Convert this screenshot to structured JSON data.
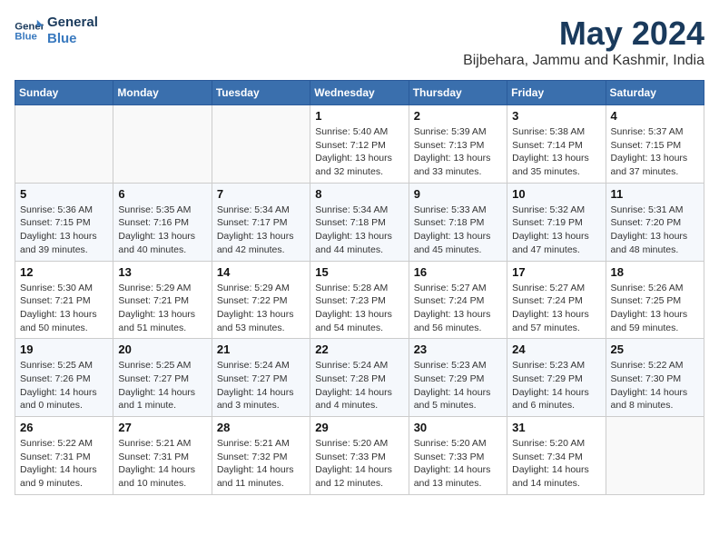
{
  "header": {
    "logo_line1": "General",
    "logo_line2": "Blue",
    "month": "May 2024",
    "location": "Bijbehara, Jammu and Kashmir, India"
  },
  "weekdays": [
    "Sunday",
    "Monday",
    "Tuesday",
    "Wednesday",
    "Thursday",
    "Friday",
    "Saturday"
  ],
  "weeks": [
    [
      {
        "date": "",
        "info": ""
      },
      {
        "date": "",
        "info": ""
      },
      {
        "date": "",
        "info": ""
      },
      {
        "date": "1",
        "info": "Sunrise: 5:40 AM\nSunset: 7:12 PM\nDaylight: 13 hours\nand 32 minutes."
      },
      {
        "date": "2",
        "info": "Sunrise: 5:39 AM\nSunset: 7:13 PM\nDaylight: 13 hours\nand 33 minutes."
      },
      {
        "date": "3",
        "info": "Sunrise: 5:38 AM\nSunset: 7:14 PM\nDaylight: 13 hours\nand 35 minutes."
      },
      {
        "date": "4",
        "info": "Sunrise: 5:37 AM\nSunset: 7:15 PM\nDaylight: 13 hours\nand 37 minutes."
      }
    ],
    [
      {
        "date": "5",
        "info": "Sunrise: 5:36 AM\nSunset: 7:15 PM\nDaylight: 13 hours\nand 39 minutes."
      },
      {
        "date": "6",
        "info": "Sunrise: 5:35 AM\nSunset: 7:16 PM\nDaylight: 13 hours\nand 40 minutes."
      },
      {
        "date": "7",
        "info": "Sunrise: 5:34 AM\nSunset: 7:17 PM\nDaylight: 13 hours\nand 42 minutes."
      },
      {
        "date": "8",
        "info": "Sunrise: 5:34 AM\nSunset: 7:18 PM\nDaylight: 13 hours\nand 44 minutes."
      },
      {
        "date": "9",
        "info": "Sunrise: 5:33 AM\nSunset: 7:18 PM\nDaylight: 13 hours\nand 45 minutes."
      },
      {
        "date": "10",
        "info": "Sunrise: 5:32 AM\nSunset: 7:19 PM\nDaylight: 13 hours\nand 47 minutes."
      },
      {
        "date": "11",
        "info": "Sunrise: 5:31 AM\nSunset: 7:20 PM\nDaylight: 13 hours\nand 48 minutes."
      }
    ],
    [
      {
        "date": "12",
        "info": "Sunrise: 5:30 AM\nSunset: 7:21 PM\nDaylight: 13 hours\nand 50 minutes."
      },
      {
        "date": "13",
        "info": "Sunrise: 5:29 AM\nSunset: 7:21 PM\nDaylight: 13 hours\nand 51 minutes."
      },
      {
        "date": "14",
        "info": "Sunrise: 5:29 AM\nSunset: 7:22 PM\nDaylight: 13 hours\nand 53 minutes."
      },
      {
        "date": "15",
        "info": "Sunrise: 5:28 AM\nSunset: 7:23 PM\nDaylight: 13 hours\nand 54 minutes."
      },
      {
        "date": "16",
        "info": "Sunrise: 5:27 AM\nSunset: 7:24 PM\nDaylight: 13 hours\nand 56 minutes."
      },
      {
        "date": "17",
        "info": "Sunrise: 5:27 AM\nSunset: 7:24 PM\nDaylight: 13 hours\nand 57 minutes."
      },
      {
        "date": "18",
        "info": "Sunrise: 5:26 AM\nSunset: 7:25 PM\nDaylight: 13 hours\nand 59 minutes."
      }
    ],
    [
      {
        "date": "19",
        "info": "Sunrise: 5:25 AM\nSunset: 7:26 PM\nDaylight: 14 hours\nand 0 minutes."
      },
      {
        "date": "20",
        "info": "Sunrise: 5:25 AM\nSunset: 7:27 PM\nDaylight: 14 hours\nand 1 minute."
      },
      {
        "date": "21",
        "info": "Sunrise: 5:24 AM\nSunset: 7:27 PM\nDaylight: 14 hours\nand 3 minutes."
      },
      {
        "date": "22",
        "info": "Sunrise: 5:24 AM\nSunset: 7:28 PM\nDaylight: 14 hours\nand 4 minutes."
      },
      {
        "date": "23",
        "info": "Sunrise: 5:23 AM\nSunset: 7:29 PM\nDaylight: 14 hours\nand 5 minutes."
      },
      {
        "date": "24",
        "info": "Sunrise: 5:23 AM\nSunset: 7:29 PM\nDaylight: 14 hours\nand 6 minutes."
      },
      {
        "date": "25",
        "info": "Sunrise: 5:22 AM\nSunset: 7:30 PM\nDaylight: 14 hours\nand 8 minutes."
      }
    ],
    [
      {
        "date": "26",
        "info": "Sunrise: 5:22 AM\nSunset: 7:31 PM\nDaylight: 14 hours\nand 9 minutes."
      },
      {
        "date": "27",
        "info": "Sunrise: 5:21 AM\nSunset: 7:31 PM\nDaylight: 14 hours\nand 10 minutes."
      },
      {
        "date": "28",
        "info": "Sunrise: 5:21 AM\nSunset: 7:32 PM\nDaylight: 14 hours\nand 11 minutes."
      },
      {
        "date": "29",
        "info": "Sunrise: 5:20 AM\nSunset: 7:33 PM\nDaylight: 14 hours\nand 12 minutes."
      },
      {
        "date": "30",
        "info": "Sunrise: 5:20 AM\nSunset: 7:33 PM\nDaylight: 14 hours\nand 13 minutes."
      },
      {
        "date": "31",
        "info": "Sunrise: 5:20 AM\nSunset: 7:34 PM\nDaylight: 14 hours\nand 14 minutes."
      },
      {
        "date": "",
        "info": ""
      }
    ]
  ]
}
